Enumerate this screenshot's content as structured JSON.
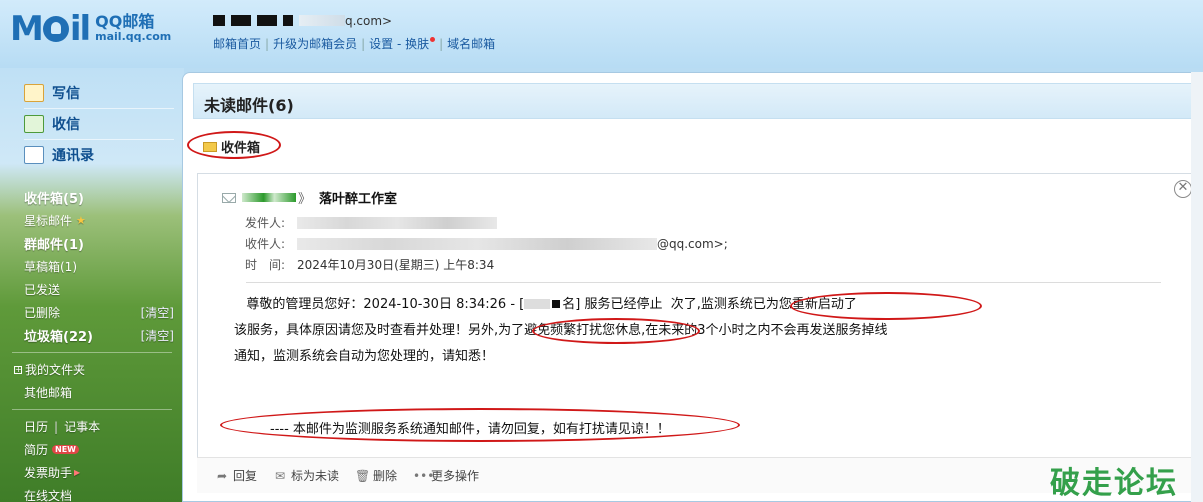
{
  "header": {
    "brand": "QQ邮箱",
    "domain": "mail.qq.com",
    "account_suffix": "q.com>",
    "nav": [
      "邮箱首页",
      "升级为邮箱会员",
      "设置 - 换肤",
      "域名邮箱"
    ]
  },
  "sidebar": {
    "quick": [
      {
        "label": "写信",
        "icon": "pencil-icon"
      },
      {
        "label": "收信",
        "icon": "download-icon"
      },
      {
        "label": "通讯录",
        "icon": "contacts-icon"
      }
    ],
    "folders": [
      {
        "label": "收件箱(5)",
        "bold": true
      },
      {
        "label": "星标邮件",
        "icon": "star-icon"
      },
      {
        "label": "群邮件(1)",
        "bold": true
      },
      {
        "label": "草稿箱(1)"
      },
      {
        "label": "已发送"
      },
      {
        "label": "已删除",
        "action": "[清空]"
      },
      {
        "label": "垃圾箱(22)",
        "bold": true,
        "action": "[清空]"
      }
    ],
    "extra": [
      "我的文件夹",
      "其他邮箱"
    ],
    "apps": [
      "日历",
      "记事本",
      "简历",
      "发票助手",
      "在线文档"
    ],
    "new_badge": "NEW"
  },
  "main": {
    "title": "未读邮件(6)",
    "folder": "收件箱",
    "email": {
      "sender_marker": "》",
      "subject": "落叶醉工作室",
      "from_label": "发件人:",
      "to_label": "收件人:",
      "to_suffix": "@qq.com>;",
      "time_label": "时　间:",
      "time": "2024年10月30日(星期三) 上午8:34",
      "body_p1_a": "尊敬的管理员您好：2024-10-30日 8:34:26  - [",
      "body_p1_b": "名] 服务已经停止",
      "body_p1_c": "次了,",
      "body_hl1": "监测系统已为您重新启动了",
      "body_p2_a": "该服务，具体原因请您及时查看并处理！另外,",
      "body_hl2": "为了避免频繁打扰您休息,",
      "body_p2_b": "在未来的3个小时之内不会再发送服务掉线",
      "body_p3": "通知，监测系统会自动为您处理的，请知悉！",
      "footer": "---- 本邮件为监测服务系统通知邮件，请勿回复，如有打扰请见谅！！"
    },
    "actions": [
      {
        "label": "回复",
        "icon": "reply-icon"
      },
      {
        "label": "标为未读",
        "icon": "envelope-icon"
      },
      {
        "label": "删除",
        "icon": "trash-icon"
      },
      {
        "label": "更多操作",
        "icon": "more-icon"
      }
    ]
  },
  "watermark": "破走论坛"
}
